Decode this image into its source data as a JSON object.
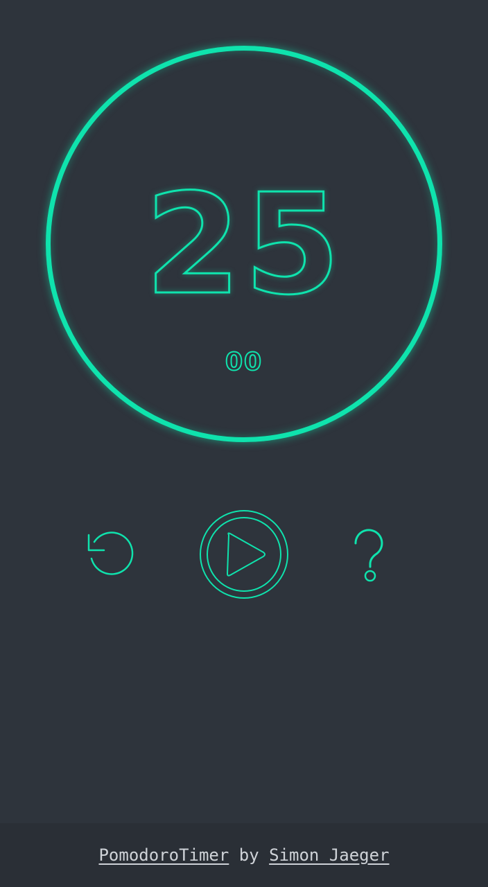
{
  "timer": {
    "minutes": "25",
    "seconds": "00"
  },
  "controls": {
    "reset_icon": "reset-icon",
    "play_icon": "play-icon",
    "help_icon": "help-icon"
  },
  "footer": {
    "app_link": "PomodoroTimer",
    "by_text": "by",
    "author_link": "Simon Jaeger"
  },
  "colors": {
    "background": "#2e343c",
    "accent": "#0fe3ad",
    "footer_background": "#2a2f36",
    "footer_text": "#cfd3d8"
  }
}
